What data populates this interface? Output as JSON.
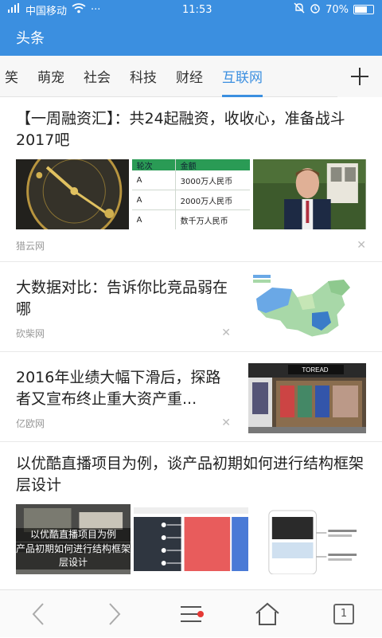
{
  "status": {
    "carrier": "中国移动",
    "time": "11:53",
    "battery": "70%",
    "battery_level": 0.7
  },
  "appbar": {
    "title": "头条"
  },
  "tabs": [
    {
      "label": "笑"
    },
    {
      "label": "萌宠"
    },
    {
      "label": "社会"
    },
    {
      "label": "科技"
    },
    {
      "label": "财经"
    },
    {
      "label": "互联网",
      "active": true
    }
  ],
  "articles": {
    "a1": {
      "title": "【一周融资汇】：共24起融资，收收心，准备战斗2017吧",
      "source": "猎云网",
      "table": {
        "headers": [
          "轮次",
          "金额"
        ],
        "rows": [
          [
            "A",
            "3000万人民币"
          ],
          [
            "A",
            "2000万人民币"
          ],
          [
            "A",
            "数千万人民币"
          ]
        ]
      }
    },
    "a2": {
      "title": "大数据对比：告诉你比竞品弱在哪",
      "source": "砍柴网"
    },
    "a3": {
      "title": "2016年业绩大幅下滑后，探路者又宣布终止重大资产重...",
      "source": "亿欧网",
      "store_sign": "TOREAD"
    },
    "a4": {
      "title": "以优酷直播项目为例，谈产品初期如何进行结构框架层设计",
      "thumb_caption_1": "以优酷直播项目为例",
      "thumb_caption_2": "产品初期如何进行结构框架层设计"
    }
  },
  "colors": {
    "accent": "#3b8fe0",
    "dot": "#e53935"
  },
  "bottombar": {
    "tab_count": "1"
  }
}
